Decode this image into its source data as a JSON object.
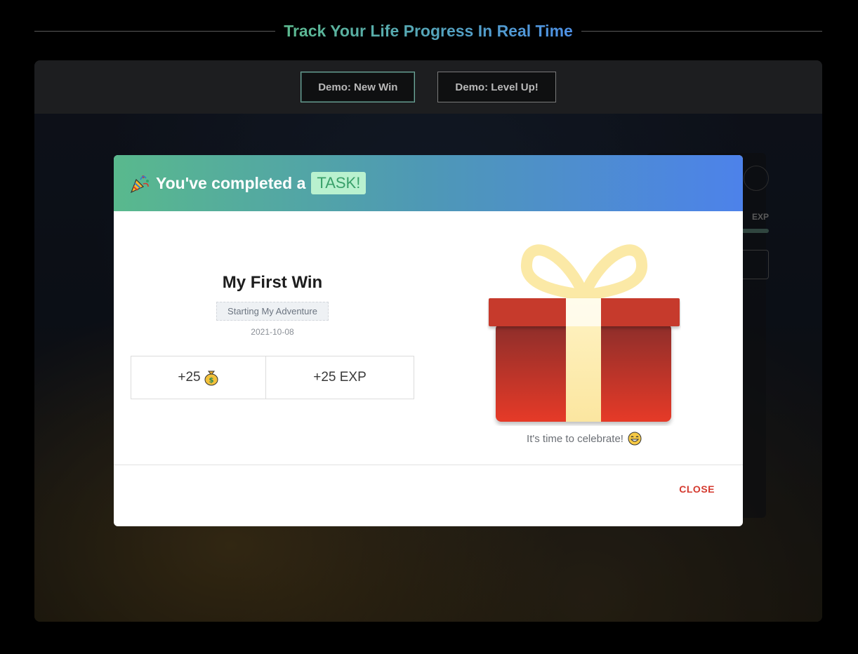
{
  "header": {
    "title": "Track Your Life Progress In Real Time"
  },
  "toolbar": {
    "buttons": [
      {
        "label": "Demo: New Win"
      },
      {
        "label": "Demo: Level Up!"
      }
    ]
  },
  "background": {
    "exp_label": "EXP"
  },
  "modal": {
    "title_prefix": "You've completed a",
    "title_chip": "TASK!",
    "win_title": "My First Win",
    "tag": "Starting My Adventure",
    "date": "2021-10-08",
    "rewards": {
      "gold": "+25",
      "exp": "+25 EXP"
    },
    "celebrate": "It's time to celebrate!",
    "close_label": "CLOSE",
    "icons": [
      "party-popper-icon",
      "money-bag-icon",
      "grinning-face-icon",
      "gift-icon"
    ]
  },
  "colors": {
    "title_gradient_start": "#5dbb8c",
    "title_gradient_end": "#4d8fe8",
    "chip_bg": "#b9f1cf",
    "chip_text": "#39a06a",
    "close_text": "#d43a2f",
    "gift_red": "#c93427",
    "ribbon": "#fbeaa4"
  }
}
